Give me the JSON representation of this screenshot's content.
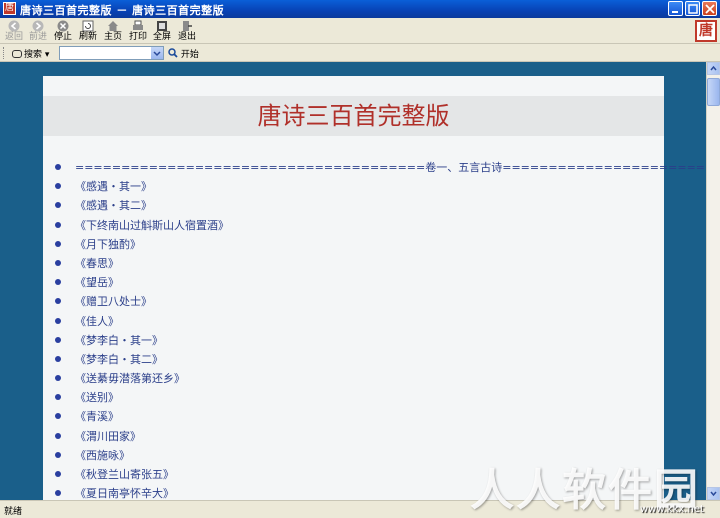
{
  "window": {
    "title": "唐诗三百首完整版 － 唐诗三百首完整版",
    "app_icon_char": "唐"
  },
  "toolbar": {
    "buttons": [
      {
        "label": "返回",
        "icon": "back-arrow-icon",
        "enabled": false
      },
      {
        "label": "前进",
        "icon": "forward-arrow-icon",
        "enabled": false
      },
      {
        "label": "停止",
        "icon": "stop-icon",
        "enabled": true
      },
      {
        "label": "刷新",
        "icon": "refresh-icon",
        "enabled": true
      },
      {
        "label": "主页",
        "icon": "home-icon",
        "enabled": true
      },
      {
        "label": "打印",
        "icon": "print-icon",
        "enabled": true
      },
      {
        "label": "全屏",
        "icon": "fullscreen-icon",
        "enabled": true
      },
      {
        "label": "退出",
        "icon": "exit-icon",
        "enabled": true
      }
    ],
    "brand_char": "唐"
  },
  "search": {
    "label": "搜索",
    "value": "",
    "go_label": "开始"
  },
  "page": {
    "title": "唐诗三百首完整版",
    "section_header": "======================================卷一、五言古诗======================================",
    "items": [
      "《感遇・其一》",
      "《感遇・其二》",
      "《下终南山过斛斯山人宿置酒》",
      "《月下独酌》",
      "《春思》",
      "《望岳》",
      "《赠卫八处士》",
      "《佳人》",
      "《梦李白・其一》",
      "《梦李白・其二》",
      "《送綦毋潜落第还乡》",
      "《送别》",
      "《青溪》",
      "《渭川田家》",
      "《西施咏》",
      "《秋登兰山寄张五》",
      "《夏日南亭怀辛大》"
    ]
  },
  "status": {
    "text": "就绪"
  },
  "watermark": {
    "text": "人人软件园",
    "url": "www.kkx.net"
  },
  "colors": {
    "titlebar": "#0a5fd8",
    "content_bg": "#1a5f8a",
    "page_bg": "#f4f6f7",
    "page_title": "#b0302a",
    "list_text": "#2b3f8a"
  }
}
